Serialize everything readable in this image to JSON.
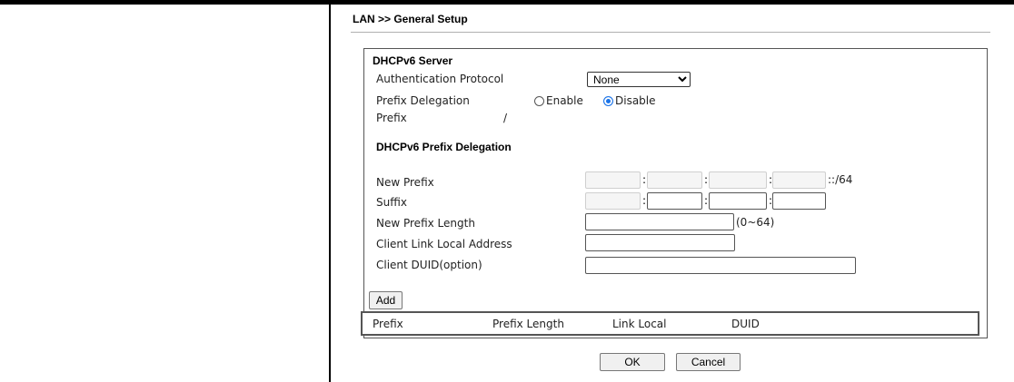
{
  "header": {
    "title": "LAN >> General Setup"
  },
  "dhcpv6_server": {
    "heading": "DHCPv6 Server",
    "auth_protocol": {
      "label": "Authentication Protocol",
      "selected": "None"
    },
    "prefix_delegation": {
      "label": "Prefix Delegation",
      "enable_label": "Enable",
      "disable_label": "Disable",
      "selected": "Disable"
    },
    "prefix": {
      "label": "Prefix",
      "value": "/"
    }
  },
  "prefix_delegation_section": {
    "heading": "DHCPv6 Prefix Delegation",
    "new_prefix": {
      "label": "New Prefix",
      "suffix_text": "::/64",
      "fields": [
        "",
        "",
        "",
        ""
      ]
    },
    "suffix": {
      "label": "Suffix",
      "fields": [
        "",
        "",
        "",
        ""
      ]
    },
    "new_prefix_length": {
      "label": "New Prefix Length",
      "value": "",
      "hint": "(0~64)"
    },
    "client_link_local": {
      "label": "Client Link Local Address",
      "value": ""
    },
    "client_duid": {
      "label": "Client DUID(option)",
      "value": ""
    }
  },
  "add_button_label": "Add",
  "delegation_table": {
    "columns": [
      "Prefix",
      "Prefix Length",
      "Link Local",
      "DUID"
    ]
  },
  "footer": {
    "ok_label": "OK",
    "cancel_label": "Cancel"
  }
}
